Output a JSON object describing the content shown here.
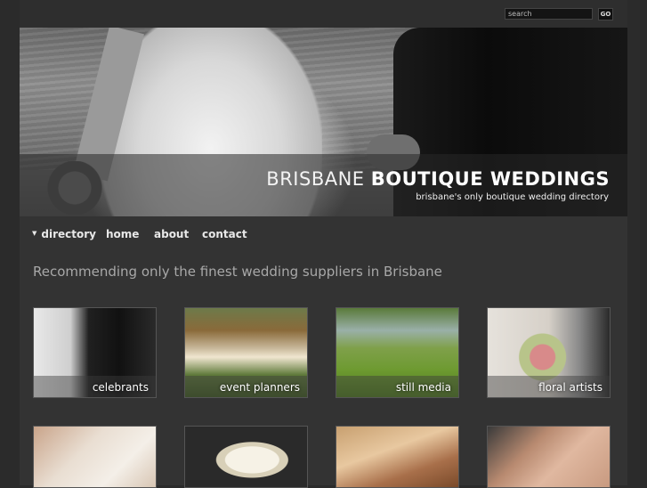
{
  "search": {
    "placeholder": "search",
    "go_label": "GO"
  },
  "hero": {
    "title_light": "BRISBANE",
    "title_bold": "BOUTIQUE WEDDINGS",
    "tagline": "brisbane's only boutique wedding directory"
  },
  "nav": {
    "items": [
      {
        "label": "directory"
      },
      {
        "label": "home"
      },
      {
        "label": "about"
      },
      {
        "label": "contact"
      }
    ]
  },
  "main": {
    "heading": "Recommending only the finest wedding suppliers in Brisbane",
    "categories": [
      {
        "label": "celebrants"
      },
      {
        "label": "event planners"
      },
      {
        "label": "still media"
      },
      {
        "label": "floral artists"
      }
    ]
  }
}
